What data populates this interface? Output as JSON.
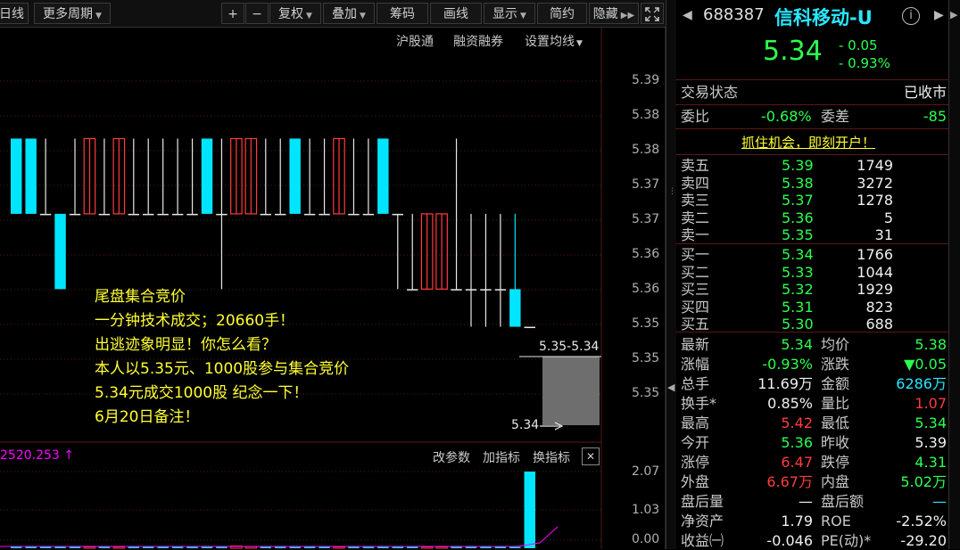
{
  "toolbar": {
    "left_label": "日线",
    "more_periods": "更多周期",
    "zoom_in": "+",
    "zoom_out": "−",
    "fuquan": "复权",
    "diejia": "叠加",
    "chouma": "筹码",
    "huaxian": "画线",
    "xianshi": "显示",
    "jianjia": "简约",
    "yincang": "隐藏"
  },
  "chart": {
    "links": {
      "hgt": "沪股通",
      "rzrq": "融资融券",
      "junxian": "设置均线"
    },
    "price_axis": [
      "5.39",
      "5.38",
      "5.38",
      "5.37",
      "5.37",
      "5.36",
      "5.36",
      "5.35",
      "5.35"
    ],
    "auction_range": "5.35-5.34",
    "auction_price": "5.34",
    "annotation": [
      "尾盘集合竞价",
      "一分钟技术成交；20660手！",
      "出逃迹象明显！你怎么看？",
      "本人以5.35元、1000股参与集合竞价",
      "5.34元成交1000股 纪念一下！",
      "6月20日备注！"
    ],
    "indicator_value": "2520.253",
    "indicator_arrow": "↑",
    "sub_links": {
      "params": "改参数",
      "add": "加指标",
      "switch": "换指标",
      "close": "✕"
    },
    "volume_axis": [
      "2.07",
      "1.03",
      "0.00"
    ],
    "colors": {
      "up": "#ff3b3b",
      "down": "#00e5ff",
      "neutral": "#e8e8e8",
      "indicator": "#ff00ff"
    }
  },
  "chart_data": {
    "type": "candlestick",
    "ylim": [
      5.345,
      5.39
    ],
    "candles": [
      {
        "o": 5.38,
        "c": 5.37,
        "h": 5.38,
        "l": 5.37
      },
      {
        "o": 5.38,
        "c": 5.37,
        "h": 5.38,
        "l": 5.37
      },
      {
        "o": 5.37,
        "c": 5.37,
        "h": 5.38,
        "l": 5.37
      },
      {
        "o": 5.37,
        "c": 5.36,
        "h": 5.37,
        "l": 5.36
      },
      {
        "o": 5.37,
        "c": 5.37,
        "h": 5.38,
        "l": 5.37
      },
      {
        "o": 5.37,
        "c": 5.38,
        "h": 5.38,
        "l": 5.37
      },
      {
        "o": 5.37,
        "c": 5.37,
        "h": 5.38,
        "l": 5.37
      },
      {
        "o": 5.37,
        "c": 5.38,
        "h": 5.38,
        "l": 5.37
      },
      {
        "o": 5.37,
        "c": 5.37,
        "h": 5.38,
        "l": 5.37
      },
      {
        "o": 5.37,
        "c": 5.37,
        "h": 5.38,
        "l": 5.37
      },
      {
        "o": 5.37,
        "c": 5.37,
        "h": 5.38,
        "l": 5.37
      },
      {
        "o": 5.37,
        "c": 5.37,
        "h": 5.38,
        "l": 5.37
      },
      {
        "o": 5.37,
        "c": 5.37,
        "h": 5.38,
        "l": 5.37
      },
      {
        "o": 5.38,
        "c": 5.37,
        "h": 5.38,
        "l": 5.37
      },
      {
        "o": 5.37,
        "c": 5.37,
        "h": 5.38,
        "l": 5.36
      },
      {
        "o": 5.37,
        "c": 5.38,
        "h": 5.38,
        "l": 5.37
      },
      {
        "o": 5.37,
        "c": 5.38,
        "h": 5.38,
        "l": 5.37
      },
      {
        "o": 5.37,
        "c": 5.37,
        "h": 5.38,
        "l": 5.37
      },
      {
        "o": 5.37,
        "c": 5.37,
        "h": 5.38,
        "l": 5.37
      },
      {
        "o": 5.38,
        "c": 5.37,
        "h": 5.38,
        "l": 5.37
      },
      {
        "o": 5.37,
        "c": 5.37,
        "h": 5.38,
        "l": 5.37
      },
      {
        "o": 5.37,
        "c": 5.37,
        "h": 5.38,
        "l": 5.37
      },
      {
        "o": 5.37,
        "c": 5.38,
        "h": 5.38,
        "l": 5.37
      },
      {
        "o": 5.37,
        "c": 5.37,
        "h": 5.38,
        "l": 5.37
      },
      {
        "o": 5.37,
        "c": 5.37,
        "h": 5.38,
        "l": 5.37
      },
      {
        "o": 5.38,
        "c": 5.37,
        "h": 5.38,
        "l": 5.37
      },
      {
        "o": 5.37,
        "c": 5.37,
        "h": 5.37,
        "l": 5.36
      },
      {
        "o": 5.36,
        "c": 5.36,
        "h": 5.37,
        "l": 5.36
      },
      {
        "o": 5.36,
        "c": 5.37,
        "h": 5.37,
        "l": 5.36
      },
      {
        "o": 5.36,
        "c": 5.37,
        "h": 5.37,
        "l": 5.36
      },
      {
        "o": 5.36,
        "c": 5.36,
        "h": 5.38,
        "l": 5.36
      },
      {
        "o": 5.36,
        "c": 5.36,
        "h": 5.37,
        "l": 5.355
      },
      {
        "o": 5.36,
        "c": 5.36,
        "h": 5.37,
        "l": 5.355
      },
      {
        "o": 5.36,
        "c": 5.36,
        "h": 5.37,
        "l": 5.355
      },
      {
        "o": 5.36,
        "c": 5.355,
        "h": 5.37,
        "l": 5.355
      },
      {
        "o": 5.355,
        "c": 5.355,
        "h": 5.355,
        "l": 5.355
      }
    ],
    "volume": [
      0.02,
      0.02,
      0.01,
      0.03,
      0.01,
      0.02,
      0.01,
      0.02,
      0.01,
      0.02,
      0.01,
      0.02,
      0.01,
      0.02,
      0.03,
      0.06,
      0.04,
      0.02,
      0.01,
      0.02,
      0.01,
      0.02,
      0.02,
      0.01,
      0.03,
      0.02,
      0.01,
      0.01,
      0.02,
      0.02,
      0.03,
      0.05,
      0.02,
      0.02,
      0.03,
      2.07
    ]
  },
  "quote": {
    "code": "688387",
    "name": "信科移动-U",
    "price": "5.34",
    "change": "- 0.05",
    "change_pct": "- 0.93%",
    "status_label": "交易状态",
    "status_value": "已收市",
    "weibi_label": "委比",
    "weibi_value": "-0.68%",
    "weicha_label": "委差",
    "weicha_value": "-85",
    "ad_text": "抓住机会，即刻开户！",
    "asks": [
      {
        "label": "卖五",
        "price": "5.39",
        "vol": "1749"
      },
      {
        "label": "卖四",
        "price": "5.38",
        "vol": "3272"
      },
      {
        "label": "卖三",
        "price": "5.37",
        "vol": "1278"
      },
      {
        "label": "卖二",
        "price": "5.36",
        "vol": "5"
      },
      {
        "label": "卖一",
        "price": "5.35",
        "vol": "31"
      }
    ],
    "bids": [
      {
        "label": "买一",
        "price": "5.34",
        "vol": "1766"
      },
      {
        "label": "买二",
        "price": "5.33",
        "vol": "1044"
      },
      {
        "label": "买三",
        "price": "5.32",
        "vol": "1929"
      },
      {
        "label": "买四",
        "price": "5.31",
        "vol": "823"
      },
      {
        "label": "买五",
        "price": "5.30",
        "vol": "688"
      }
    ],
    "stats": [
      {
        "l1": "最新",
        "v1": "5.34",
        "c1": "grn",
        "l2": "均价",
        "v2": "5.38",
        "c2": "grn"
      },
      {
        "l1": "涨幅",
        "v1": "-0.93%",
        "c1": "grn",
        "l2": "涨跌",
        "v2": "▼0.05",
        "c2": "grn"
      },
      {
        "l1": "总手",
        "v1": "11.69万",
        "c1": "wht",
        "l2": "金额",
        "v2": "6286万",
        "c2": "cyan"
      },
      {
        "l1": "换手*",
        "v1": "0.85%",
        "c1": "wht",
        "l2": "量比",
        "v2": "1.07",
        "c2": "red"
      },
      {
        "l1": "最高",
        "v1": "5.42",
        "c1": "red",
        "l2": "最低",
        "v2": "5.34",
        "c2": "grn"
      },
      {
        "l1": "今开",
        "v1": "5.36",
        "c1": "grn",
        "l2": "昨收",
        "v2": "5.39",
        "c2": "wht"
      },
      {
        "l1": "涨停",
        "v1": "6.47",
        "c1": "red",
        "l2": "跌停",
        "v2": "4.31",
        "c2": "grn"
      },
      {
        "l1": "外盘",
        "v1": "6.67万",
        "c1": "red",
        "l2": "内盘",
        "v2": "5.02万",
        "c2": "grn"
      },
      {
        "l1": "盘后量",
        "v1": "—",
        "c1": "wht",
        "l2": "盘后额",
        "v2": "—",
        "c2": "cyan"
      },
      {
        "l1": "净资产",
        "v1": "1.79",
        "c1": "wht",
        "l2": "ROE",
        "v2": "-2.52%",
        "c2": "wht"
      },
      {
        "l1": "收益㈠",
        "v1": "-0.046",
        "c1": "wht",
        "l2": "PE(动)*",
        "v2": "-29.20",
        "c2": "wht"
      }
    ]
  }
}
